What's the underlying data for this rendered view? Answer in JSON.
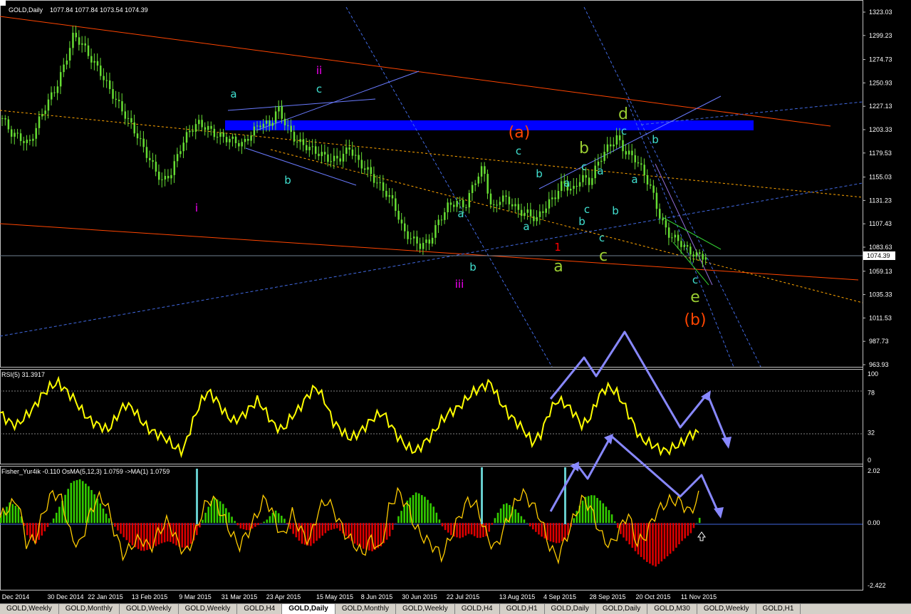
{
  "window": {
    "title": "GOLD,Daily",
    "ohlc": "1077.84 1077.84 1073.54 1074.39"
  },
  "tabs": [
    "GOLD,Weekly",
    "GOLD,Monthly",
    "GOLD,Weekly",
    "GOLD,Weekly",
    "GOLD,H4",
    "GOLD,Daily",
    "GOLD,Monthly",
    "GOLD,Weekly",
    "GOLD,H4",
    "GOLD,H1",
    "GOLD,Daily",
    "GOLD,Daily",
    "GOLD,M30",
    "GOLD,Weekly",
    "GOLD,H1"
  ],
  "active_tab": 5,
  "colors": {
    "background": "#000000",
    "bull_candle": "#66dd33",
    "rsi_line": "#ffff00",
    "fisher_line": "#ffcc00",
    "histogram_positive": "#33cc00",
    "histogram_negative": "#dd0000",
    "resistance_zone": "#0000ff",
    "trend_lines": "#ff4500",
    "arrows": "#8888ff"
  },
  "chart_data": [
    {
      "type": "candlestick",
      "title": "GOLD,Daily",
      "ylim": [
        963.93,
        1323.03
      ],
      "y_ticks": [
        "1323.03",
        "1299.23",
        "1274.73",
        "1250.93",
        "1227.13",
        "1203.33",
        "1179.53",
        "1155.03",
        "1131.23",
        "1107.43",
        "1083.63",
        "1059.13",
        "1035.33",
        "1011.53",
        "987.73",
        "963.93"
      ],
      "current_price": "1074.39",
      "x_ticks": [
        "Dec 2014",
        "30 Dec 2014",
        "22 Jan 2015",
        "13 Feb 2015",
        "9 Mar 2015",
        "31 Mar 2015",
        "23 Apr 2015",
        "15 May 2015",
        "8 Jun 2015",
        "30 Jun 2015",
        "22 Jul 2015",
        "13 Aug 2015",
        "4 Sep 2015",
        "28 Sep 2015",
        "20 Oct 2015",
        "11 Nov 2015"
      ],
      "price_path": [
        1215,
        1200,
        1195,
        1188,
        1210,
        1230,
        1245,
        1270,
        1300,
        1290,
        1275,
        1262,
        1245,
        1230,
        1215,
        1200,
        1182,
        1165,
        1150,
        1160,
        1185,
        1202,
        1210,
        1205,
        1198,
        1195,
        1192,
        1188,
        1200,
        1210,
        1208,
        1225,
        1205,
        1192,
        1187,
        1182,
        1177,
        1172,
        1175,
        1185,
        1170,
        1162,
        1150,
        1140,
        1128,
        1100,
        1092,
        1085,
        1090,
        1110,
        1125,
        1130,
        1125,
        1150,
        1165,
        1120,
        1135,
        1130,
        1120,
        1118,
        1112,
        1125,
        1135,
        1150,
        1140,
        1155,
        1150,
        1172,
        1185,
        1195,
        1180,
        1175,
        1160,
        1140,
        1110,
        1095,
        1090,
        1080,
        1075,
        1074.39
      ],
      "blue_zone": [
        1203.33,
        1215
      ],
      "wave_labels": [
        {
          "text": "a",
          "color": "#40e0d0"
        },
        {
          "text": "ii",
          "color": "#ff00ff"
        },
        {
          "text": "c",
          "color": "#40e0d0"
        },
        {
          "text": "b",
          "color": "#40e0d0"
        },
        {
          "text": "i",
          "color": "#ff00ff"
        },
        {
          "text": "(a)",
          "color": "#ff4500"
        },
        {
          "text": "c",
          "color": "#40e0d0"
        },
        {
          "text": "b",
          "color": "#40e0d0"
        },
        {
          "text": "a",
          "color": "#40e0d0"
        },
        {
          "text": "b",
          "color": "#40e0d0"
        },
        {
          "text": "iii",
          "color": "#ff00ff"
        },
        {
          "text": "a",
          "color": "#40e0d0"
        },
        {
          "text": "b",
          "color": "#9acd32"
        },
        {
          "text": "c",
          "color": "#40e0d0"
        },
        {
          "text": "a",
          "color": "#40e0d0"
        },
        {
          "text": "a",
          "color": "#40e0d0"
        },
        {
          "text": "b",
          "color": "#40e0d0"
        },
        {
          "text": "c",
          "color": "#40e0d0"
        },
        {
          "text": "c",
          "color": "#40e0d0"
        },
        {
          "text": "a",
          "color": "#9acd32"
        },
        {
          "text": "c",
          "color": "#9acd32"
        },
        {
          "text": "d",
          "color": "#9acd32"
        },
        {
          "text": "c",
          "color": "#40e0d0"
        },
        {
          "text": "b",
          "color": "#40e0d0"
        },
        {
          "text": "a",
          "color": "#40e0d0"
        },
        {
          "text": "b",
          "color": "#40e0d0"
        },
        {
          "text": "c",
          "color": "#40e0d0"
        },
        {
          "text": "e",
          "color": "#9acd32"
        },
        {
          "text": "(b)",
          "color": "#ff4500"
        },
        {
          "text": "1",
          "color": "#ff0000"
        }
      ]
    },
    {
      "type": "line",
      "title": "RSI(5) 31.3917",
      "ylim": [
        0,
        100
      ],
      "y_ticks": [
        "100",
        "78",
        "32",
        "0"
      ],
      "levels": [
        78,
        32
      ],
      "values": [
        55,
        45,
        40,
        50,
        60,
        75,
        85,
        90,
        80,
        70,
        55,
        45,
        40,
        35,
        50,
        65,
        60,
        45,
        35,
        30,
        25,
        15,
        10,
        40,
        65,
        80,
        70,
        55,
        45,
        50,
        60,
        70,
        55,
        40,
        35,
        50,
        60,
        75,
        85,
        70,
        45,
        35,
        25,
        30,
        40,
        50,
        55,
        40,
        25,
        15,
        10,
        20,
        30,
        45,
        55,
        60,
        70,
        80,
        85,
        90,
        70,
        55,
        45,
        35,
        20,
        30,
        55,
        70,
        65,
        55,
        40,
        50,
        75,
        85,
        80,
        65,
        45,
        25,
        20,
        15,
        10,
        15,
        20,
        30,
        31.39
      ]
    },
    {
      "type": "histogram",
      "title": "Fisher_Yur4ik -0.110 OsMA(5,12,3) 1.0759 ->MA(1) 1.0759",
      "ylim": [
        -2.422,
        2.02
      ],
      "y_ticks": [
        "2.02",
        "0.00",
        "-2.422"
      ],
      "values": [
        0.3,
        0.8,
        0.6,
        -0.5,
        -0.8,
        -0.3,
        0.2,
        0.9,
        1.6,
        1.7,
        1.4,
        0.9,
        0.3,
        -0.2,
        -0.6,
        -0.9,
        -1.1,
        -1.0,
        -0.8,
        -0.7,
        -0.9,
        -1.0,
        -0.6,
        0.3,
        1.0,
        0.8,
        0.3,
        -0.2,
        -0.3,
        -0.1,
        0.1,
        0.5,
        0.2,
        -0.4,
        -0.8,
        -0.9,
        -0.6,
        -0.3,
        -0.2,
        -0.5,
        -0.8,
        -1.0,
        -1.1,
        -0.9,
        -0.5,
        0.3,
        0.9,
        1.2,
        1.0,
        0.6,
        -0.2,
        -0.5,
        -0.6,
        -0.4,
        -0.6,
        -0.5,
        0.3,
        0.8,
        0.6,
        0.2,
        -0.2,
        -0.5,
        -0.7,
        -0.8,
        -0.6,
        0.4,
        1.0,
        1.1,
        0.8,
        0.4,
        -0.4,
        -0.8,
        -1.2,
        -1.5,
        -1.7,
        -1.4,
        -1.1,
        -0.7,
        -0.4,
        0.2
      ],
      "fisher_line": [
        0.2,
        0.6,
        0.9,
        -0.8,
        -0.6,
        0.5,
        1.2,
        0.9,
        -0.5,
        -0.9,
        0.2,
        1.0,
        0.8,
        -0.4,
        -1.3,
        -0.8,
        -0.6,
        -1.0,
        -0.3,
        0.1,
        -0.7,
        -1.2,
        -0.5,
        0.6,
        1.0,
        0.4,
        -0.3,
        -0.9,
        -0.4,
        0.3,
        1.0,
        0.2,
        -0.6,
        0.4,
        -0.3,
        -0.7,
        0.5,
        0.9,
        0.3,
        -0.4,
        -0.8,
        -1.2,
        -0.6,
        -1.1,
        0.6,
        1.2,
        0.7,
        -0.2,
        -0.6,
        -0.9,
        -1.3,
        -0.5,
        0.3,
        0.9,
        0.6,
        -0.5,
        -1.0,
        -0.2,
        0.6,
        1.2,
        0.8,
        0.3,
        -0.8,
        -1.4,
        -0.6,
        0.3,
        1.0,
        0.4,
        -0.5,
        -0.9,
        -0.3,
        0.4,
        -0.8,
        -0.5,
        0.3,
        0.7,
        0.9,
        0.8,
        0.4,
        1.0
      ]
    }
  ]
}
